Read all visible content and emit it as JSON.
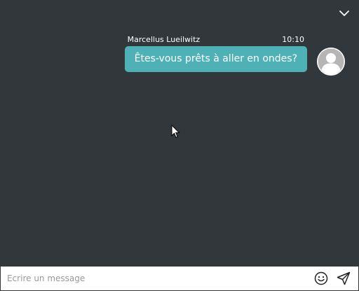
{
  "chat": {
    "messages": [
      {
        "author": "Marcellus Lueilwitz",
        "time": "10:10",
        "text": "Êtes-vous prêts à aller en ondes?"
      }
    ]
  },
  "composer": {
    "placeholder": "Ecrire un message",
    "value": ""
  },
  "icons": {
    "collapse": "chevron-down-icon",
    "emoji": "smiley-icon",
    "send": "paper-plane-icon",
    "avatar": "default-user-avatar"
  },
  "colors": {
    "background": "#32373b",
    "bubble": "#4db1b6",
    "composer": "#ffffff"
  }
}
